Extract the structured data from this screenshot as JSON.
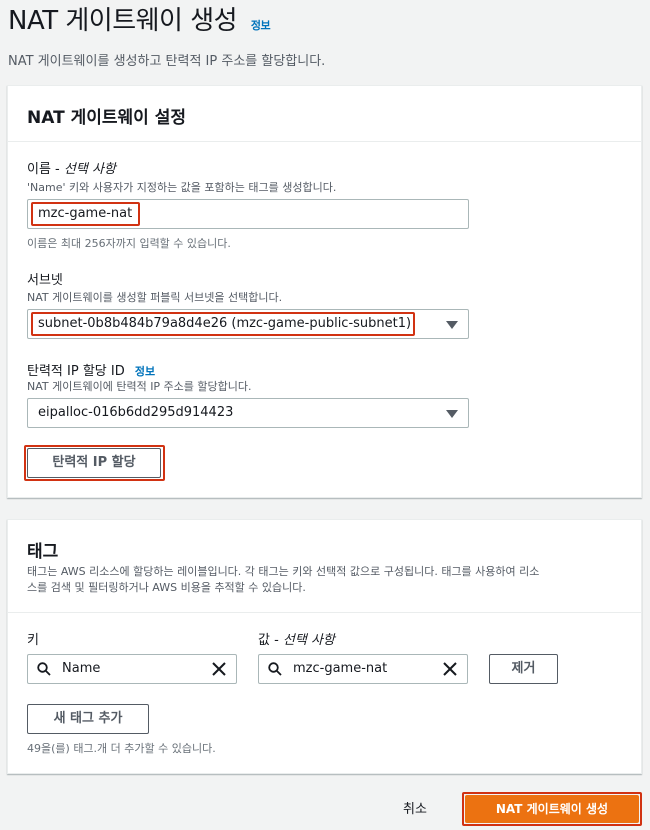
{
  "header": {
    "title": "NAT 게이트웨이 생성",
    "info_link": "정보",
    "subtitle": "NAT 게이트웨이를 생성하고 탄력적 IP 주소를 할당합니다."
  },
  "settings_panel": {
    "title": "NAT 게이트웨이 설정",
    "name_field": {
      "label": "이름 - ",
      "label_optional": "선택 사항",
      "description": "'Name' 키와 사용자가 지정하는 값을 포함하는 태그를 생성합니다.",
      "value": "mzc-game-nat",
      "hint": "이름은 최대 256자까지 입력할 수 있습니다."
    },
    "subnet_field": {
      "label": "서브넷",
      "description": "NAT 게이트웨이를 생성할 퍼블릭 서브넷을 선택합니다.",
      "selected": "subnet-0b8b484b79a8d4e26 (mzc-game-public-subnet1)"
    },
    "eip_field": {
      "label": "탄력적 IP 할당 ID",
      "info_link": "정보",
      "description": "NAT 게이트웨이에 탄력적 IP 주소를 할당합니다.",
      "selected": "eipalloc-016b6dd295d914423",
      "allocate_button": "탄력적 IP 할당"
    }
  },
  "tags_panel": {
    "title": "태그",
    "description_line1": "태그는 AWS 리소스에 할당하는 레이블입니다. 각 태그는 키와 선택적 값으로 구성됩니다. 태그를 사용하여 리소",
    "description_line2": "스를 검색 및 필터링하거나 AWS 비용을 추적할 수 있습니다.",
    "key_label": "키",
    "value_label": "값 - ",
    "value_label_optional": "선택 사항",
    "key_value": "Name",
    "value_value": "mzc-game-nat",
    "remove_button": "제거",
    "add_tag_button": "새 태그 추가",
    "remaining_hint": "49을(를) 태그.개 더 추가할 수 있습니다."
  },
  "footer": {
    "cancel": "취소",
    "submit": "NAT 게이트웨이 생성"
  },
  "colors": {
    "primary": "#ec7211",
    "link": "#0073bb",
    "highlight": "#d13212"
  }
}
